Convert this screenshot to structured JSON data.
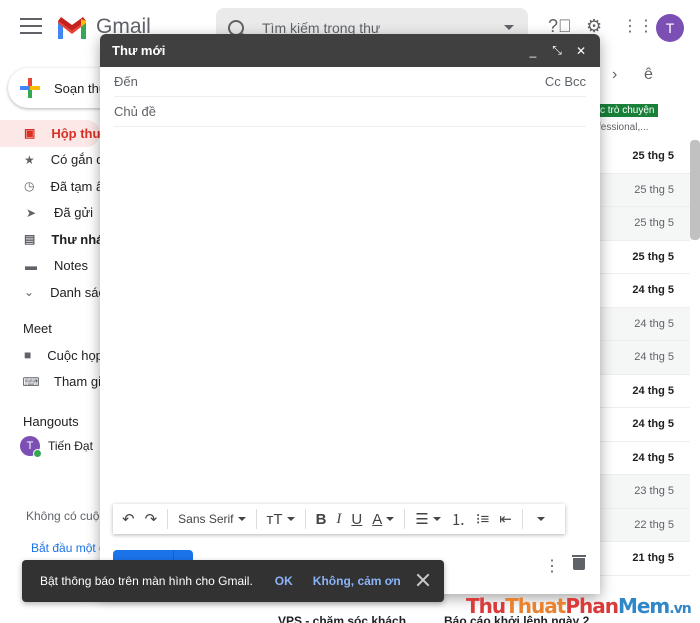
{
  "header": {
    "app_name": "Gmail",
    "search_placeholder": "Tìm kiếm trong thư",
    "avatar_letter": "T"
  },
  "sidebar": {
    "compose_label": "Soạn thư",
    "items": [
      {
        "label": "Hộp thư",
        "icon": "inbox-icon"
      },
      {
        "label": "Có gắn d",
        "icon": "star-icon"
      },
      {
        "label": "Đã tạm ẩ",
        "icon": "clock-icon"
      },
      {
        "label": "Đã gửi",
        "icon": "send-icon"
      },
      {
        "label": "Thư nháp",
        "icon": "draft-icon"
      },
      {
        "label": "Notes",
        "icon": "label-icon"
      },
      {
        "label": "Danh sác",
        "icon": "chevron-down-icon"
      }
    ],
    "meet_title": "Meet",
    "meet_items": [
      {
        "label": "Cuộc họp",
        "icon": "video-icon"
      },
      {
        "label": "Tham gia",
        "icon": "keyboard-icon"
      }
    ],
    "hangouts_title": "Hangouts",
    "hangouts_user": "Tiến Đạt",
    "hangouts_user_initial": "T",
    "no_chats": "Không có cuộc",
    "start_link": "Bắt đầu một cu"
  },
  "email_list": {
    "chip": "c trò chuyện",
    "chip_sub": "fessional,...",
    "rows": [
      {
        "date": "25 thg 5",
        "bold": true
      },
      {
        "date": "25 thg 5",
        "bold": false
      },
      {
        "date": "25 thg 5",
        "bold": false
      },
      {
        "date": "25 thg 5",
        "bold": true
      },
      {
        "date": "24 thg 5",
        "bold": true
      },
      {
        "date": "24 thg 5",
        "bold": false
      },
      {
        "date": "24 thg 5",
        "bold": false
      },
      {
        "date": "24 thg 5",
        "bold": true
      },
      {
        "date": "24 thg 5",
        "bold": true
      },
      {
        "date": "24 thg 5",
        "bold": true
      },
      {
        "date": "23 thg 5",
        "bold": false
      },
      {
        "date": "22 thg 5",
        "bold": false
      },
      {
        "date": "21 thg 5",
        "bold": true
      }
    ],
    "bottom_sender": "VPS - chăm sóc khách",
    "bottom_subject": "Báo cáo khởi lệnh ngày 2"
  },
  "compose": {
    "title": "Thư mới",
    "to_label": "Đến",
    "cc_bcc": "Cc Bcc",
    "subject_label": "Chủ đề",
    "font_name": "Sans Serif"
  },
  "snackbar": {
    "message": "Bật thông báo trên màn hình cho Gmail.",
    "ok": "OK",
    "no": "Không, cảm ơn"
  },
  "watermark": {
    "part1": "Thu",
    "part2": "Thuat",
    "part3": "Phan",
    "part4": "Mem",
    "suffix": ".vn"
  },
  "colors": {
    "accent": "#1a73e8",
    "active_nav": "#d93025",
    "compose_header": "#404040",
    "snackbar": "#323232"
  }
}
